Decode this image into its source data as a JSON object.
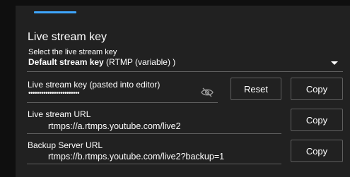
{
  "section": {
    "title": "Live stream key",
    "select_label": "Select the live stream key",
    "select_value_bold": "Default stream key",
    "select_value_rest": " (RTMP (variable) )"
  },
  "stream_key": {
    "label": "Live stream key (pasted into editor)",
    "masked_value": "••••••••••••••••••••••••",
    "reset_label": "Reset",
    "copy_label": "Copy"
  },
  "stream_url": {
    "label": "Live stream URL",
    "value": "rtmps://a.rtmps.youtube.com/live2",
    "copy_label": "Copy"
  },
  "backup_url": {
    "label": "Backup Server URL",
    "value": "rtmps://b.rtmps.youtube.com/live2?backup=1",
    "copy_label": "Copy"
  },
  "colors": {
    "background": "#0f0f0f",
    "panel": "#212121",
    "accent": "#3ea6ff",
    "divider": "#5f5f5f",
    "button_border": "#606060"
  },
  "icons": {
    "visibility_toggle": "eye-off-icon",
    "dropdown": "chevron-down-icon"
  }
}
